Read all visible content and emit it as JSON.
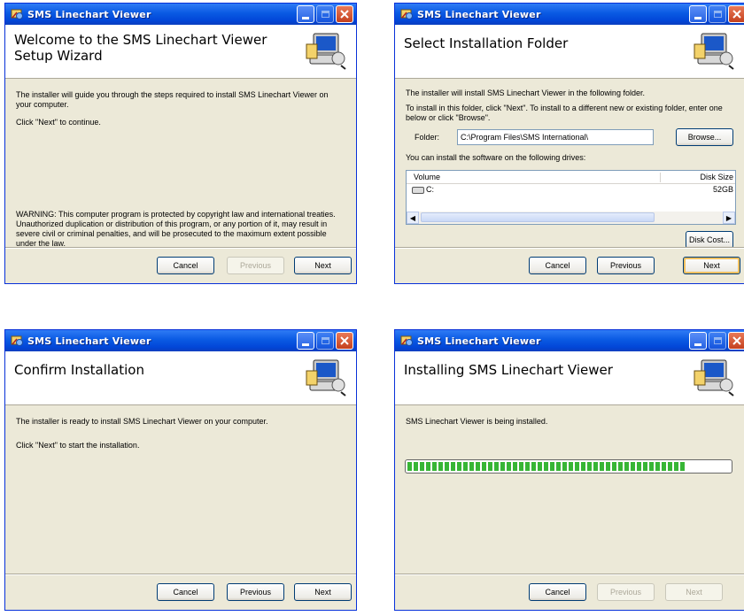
{
  "app": {
    "title": "SMS Linechart Viewer"
  },
  "buttons": {
    "cancel": "Cancel",
    "previous": "Previous",
    "next": "Next",
    "browse": "Browse...",
    "disk_cost": "Disk Cost..."
  },
  "welcome": {
    "heading": "Welcome to the SMS Linechart Viewer Setup Wizard",
    "intro": "The installer will guide you through the steps required to install SMS Linechart Viewer on your computer.",
    "click_next": "Click \"Next\" to continue.",
    "warning": "WARNING: This computer program is protected by copyright law and international treaties. Unauthorized duplication or distribution of this program, or any portion of it, may result in severe civil or criminal penalties, and will be prosecuted to the maximum extent possible under the law."
  },
  "folder": {
    "heading": "Select Installation Folder",
    "intro": "The installer will install SMS Linechart Viewer in the following folder.",
    "instructions": "To install in this folder, click \"Next\". To install to a different new or existing folder, enter one below or click \"Browse\".",
    "folder_label": "Folder:",
    "folder_value": "C:\\Program Files\\SMS International\\",
    "drives_label": "You can install the software on the following drives:",
    "columns": [
      "Volume",
      "Disk Size"
    ],
    "drives": [
      {
        "volume": "C:",
        "size": "52GB"
      }
    ]
  },
  "confirm": {
    "heading": "Confirm Installation",
    "ready": "The installer is ready to install SMS Linechart Viewer on your computer.",
    "click_next": "Click \"Next\" to start the installation."
  },
  "installing": {
    "heading": "Installing SMS Linechart Viewer",
    "status": "SMS Linechart Viewer is being installed.",
    "progress_fraction": 0.86
  }
}
